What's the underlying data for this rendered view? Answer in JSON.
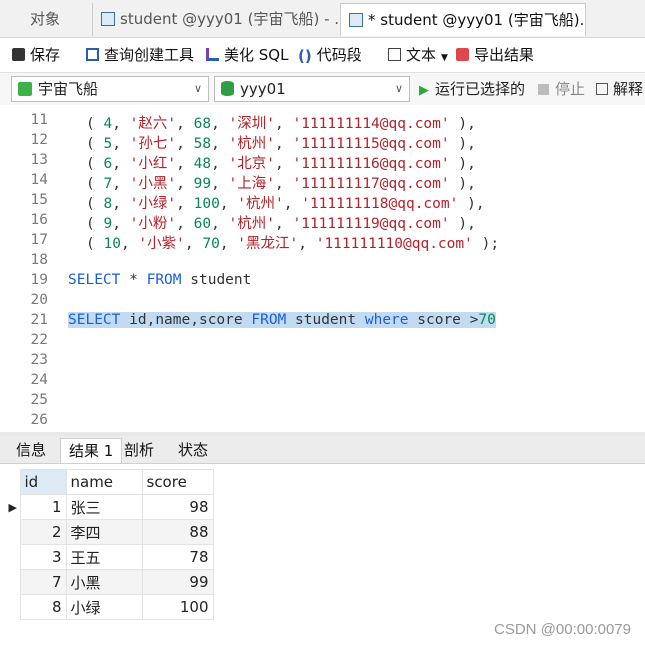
{
  "tabs": [
    {
      "label": "对象"
    },
    {
      "label": "student @yyy01 (宇宙飞船) - ..."
    },
    {
      "label": "* student @yyy01 (宇宙飞船)..."
    }
  ],
  "toolbar": {
    "save": "保存",
    "query_builder": "查询创建工具",
    "beautify_sql": "美化 SQL",
    "code_snippet": "代码段",
    "text": "文本",
    "export": "导出结果"
  },
  "selectors": {
    "connection": "宇宙飞船",
    "database": "yyy01",
    "run_selected": "运行已选择的",
    "stop": "停止",
    "explain": "解释"
  },
  "editor": {
    "lines": [
      {
        "n": "11",
        "row": [
          "4",
          "'赵六'",
          "68",
          "'深圳'",
          "'111111114@qq.com'"
        ],
        "end": ","
      },
      {
        "n": "12",
        "row": [
          "5",
          "'孙七'",
          "58",
          "'杭州'",
          "'111111115@qq.com'"
        ],
        "end": ","
      },
      {
        "n": "13",
        "row": [
          "6",
          "'小红'",
          "48",
          "'北京'",
          "'111111116@qq.com'"
        ],
        "end": ","
      },
      {
        "n": "14",
        "row": [
          "7",
          "'小黑'",
          "99",
          "'上海'",
          "'111111117@qq.com'"
        ],
        "end": ","
      },
      {
        "n": "15",
        "row": [
          "8",
          "'小绿'",
          "100",
          "'杭州'",
          "'111111118@qq.com'"
        ],
        "end": ","
      },
      {
        "n": "16",
        "row": [
          "9",
          "'小粉'",
          "60",
          "'杭州'",
          "'111111119@qq.com'"
        ],
        "end": ","
      },
      {
        "n": "17",
        "row": [
          "10",
          "'小紫'",
          "70",
          "'黑龙江'",
          "'111111110@qq.com'"
        ],
        "end": ";"
      }
    ],
    "blank_lines": [
      "18",
      "20",
      "22",
      "23",
      "24",
      "25",
      "26"
    ],
    "q1": {
      "n": "19",
      "kw1": "SELECT",
      "star": "*",
      "kw2": "FROM",
      "table": "student"
    },
    "q2": {
      "n": "21",
      "kw1": "SELECT",
      "cols": "id,name,score",
      "kw2": "FROM",
      "table": "student",
      "kw3": "where",
      "cond": "score >",
      "val": "70"
    }
  },
  "result_tabs": [
    "信息",
    "结果 1",
    "剖析",
    "状态"
  ],
  "grid": {
    "columns": [
      "id",
      "name",
      "score"
    ],
    "rows": [
      {
        "id": "1",
        "name": "张三",
        "score": "98"
      },
      {
        "id": "2",
        "name": "李四",
        "score": "88"
      },
      {
        "id": "3",
        "name": "王五",
        "score": "78"
      },
      {
        "id": "7",
        "name": "小黑",
        "score": "99"
      },
      {
        "id": "8",
        "name": "小绿",
        "score": "100"
      }
    ]
  },
  "watermark": "CSDN @00:00:0079"
}
